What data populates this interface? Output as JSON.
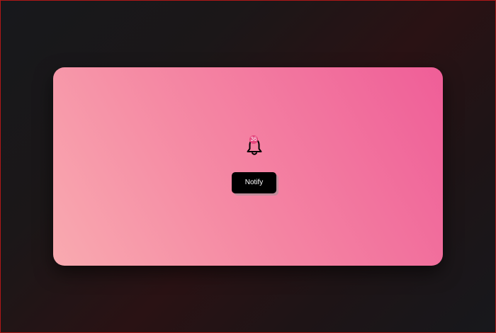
{
  "notification": {
    "count": "36",
    "button_label": "Notify"
  },
  "icons": {
    "bell": "bell-icon"
  },
  "colors": {
    "badge": "#e6457c",
    "button": "#000000",
    "card_gradient_start": "#f9aab0",
    "card_gradient_end": "#ef5e98"
  }
}
